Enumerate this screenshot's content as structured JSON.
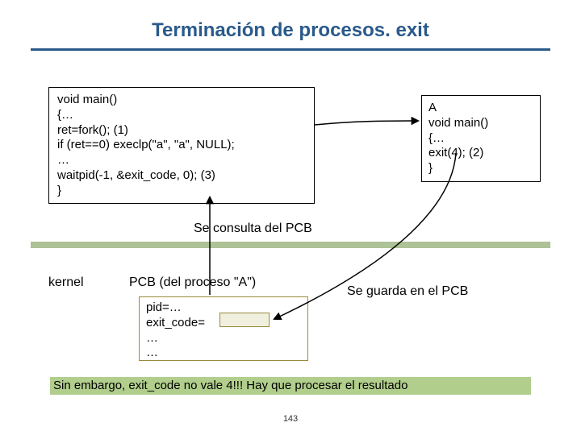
{
  "title": "Terminación de procesos. exit",
  "parent_code": [
    "void main()",
    "{…",
    "ret=fork(); (1)",
    "if (ret==0) execlp(\"a\", \"a\", NULL);",
    "…",
    "waitpid(-1, &exit_code, 0); (3)",
    "}"
  ],
  "child_label": "A",
  "child_code": [
    "void main()",
    "{…",
    "exit(4); (2)",
    "}"
  ],
  "se_consulta": "Se consulta del PCB",
  "kernel": "kernel",
  "pcb_title": "PCB (del proceso \"A\")",
  "pcb_lines": [
    "pid=…",
    "exit_code=",
    "…",
    "…"
  ],
  "se_guarda": "Se guarda en el PCB",
  "footer": "Sin embargo, exit_code no vale 4!!! Hay que procesar el resultado",
  "page": "143"
}
